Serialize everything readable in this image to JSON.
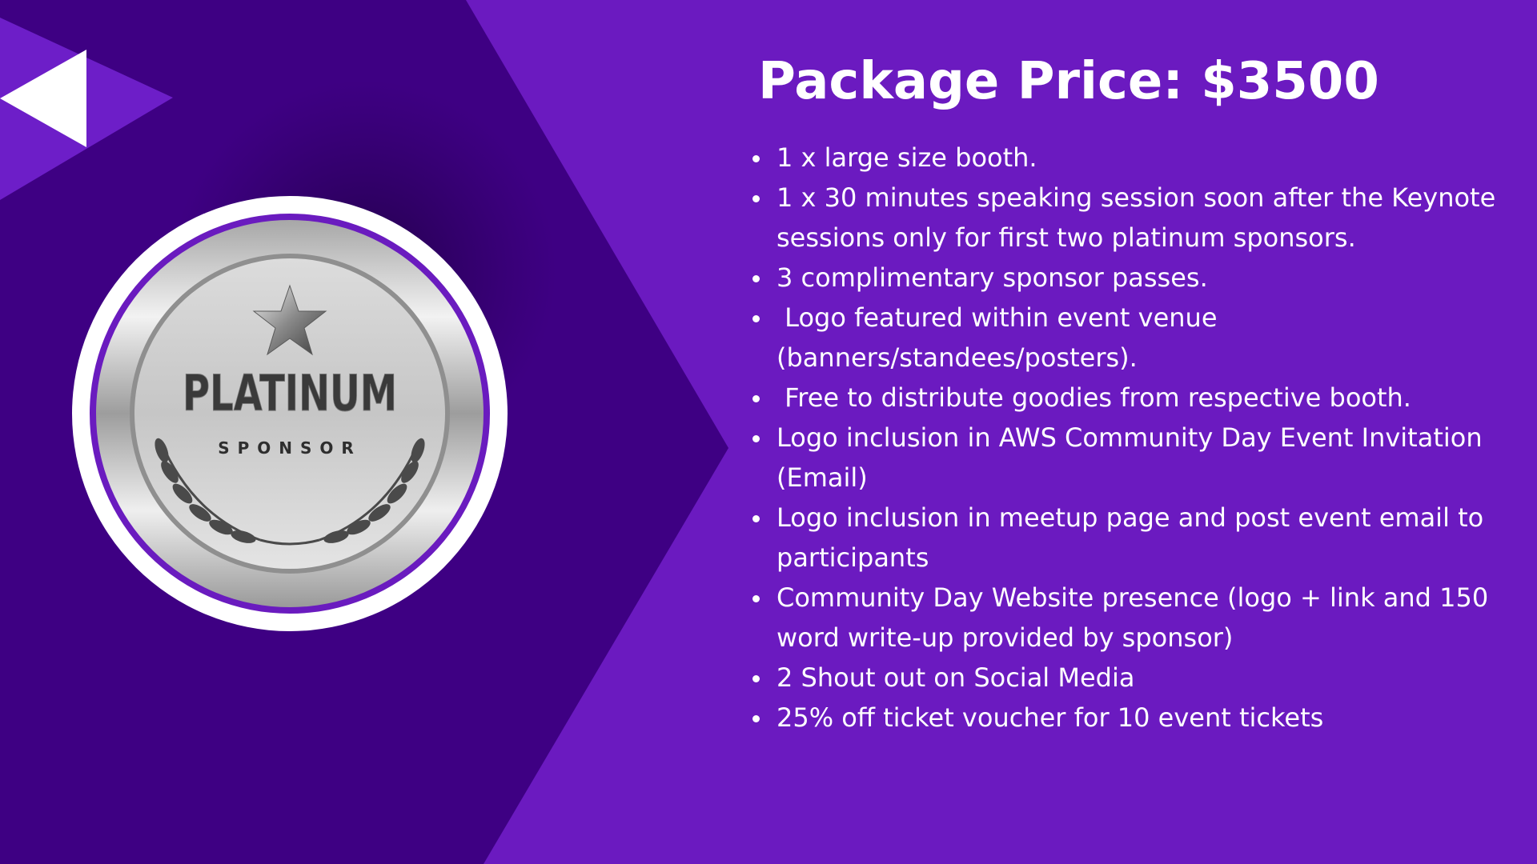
{
  "colors": {
    "background": "#6b1ac0",
    "dark_panel": "#3e0083",
    "accent_triangle": "#6d1ec8",
    "text": "#ffffff"
  },
  "badge": {
    "label_main": "PLATINUM",
    "label_sub": "SPONSOR",
    "icon": "star-icon",
    "decoration": "laurel-wreath-icon"
  },
  "decor": {
    "play_icon": "play-arrow-icon"
  },
  "package": {
    "title": "Package Price: $3500",
    "benefits": [
      "1 x large size booth.",
      "1 x 30 minutes speaking session soon after the Keynote sessions only for first two platinum sponsors.",
      "3 complimentary sponsor passes.",
      " Logo featured within event venue (banners/standees/posters).",
      " Free to distribute goodies from respective booth.",
      "Logo inclusion in AWS Community Day Event Invitation (Email)",
      "Logo inclusion in meetup page and post event email to participants",
      "Community Day Website presence (logo + link and 150 word write-up provided by sponsor)",
      "2 Shout out on Social Media",
      "25% off ticket voucher for 10 event tickets"
    ]
  }
}
